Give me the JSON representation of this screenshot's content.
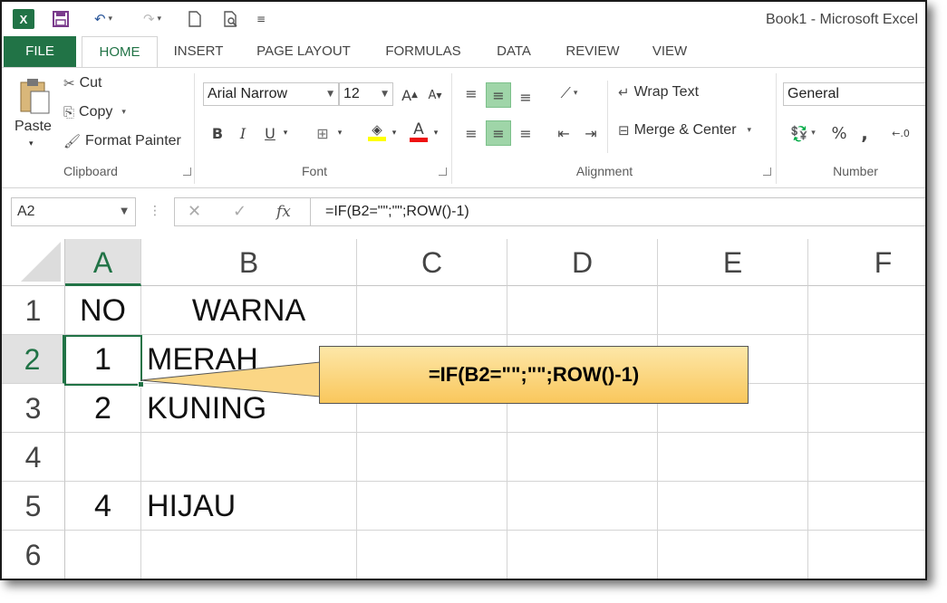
{
  "window": {
    "title": "Book1 - Microsoft Excel"
  },
  "tabs": [
    "FILE",
    "HOME",
    "INSERT",
    "PAGE LAYOUT",
    "FORMULAS",
    "DATA",
    "REVIEW",
    "VIEW"
  ],
  "ribbon": {
    "clipboard": {
      "label": "Clipboard",
      "paste": "Paste",
      "cut": "Cut",
      "copy": "Copy",
      "format_painter": "Format Painter"
    },
    "font": {
      "label": "Font",
      "font_name": "Arial Narrow",
      "font_size": "12",
      "bold": "B",
      "italic": "I",
      "underline": "U"
    },
    "alignment": {
      "label": "Alignment",
      "wrap_text": "Wrap Text",
      "merge_center": "Merge & Center"
    },
    "number": {
      "label": "Number",
      "format": "General",
      "percent": "%",
      "comma": ","
    }
  },
  "formula_bar": {
    "name_box": "A2",
    "fx": "fx",
    "formula": "=IF(B2=\"\";\"\";ROW()-1)"
  },
  "columns": [
    "A",
    "B",
    "C",
    "D",
    "E",
    "F"
  ],
  "rows": [
    "1",
    "2",
    "3",
    "4",
    "5",
    "6"
  ],
  "cells": {
    "A1": "NO",
    "B1": "WARNA",
    "A2": "1",
    "B2": "MERAH",
    "A3": "2",
    "B3": "KUNING",
    "A4": "",
    "B4": "",
    "A5": "4",
    "B5": "HIJAU",
    "A6": "",
    "B6": ""
  },
  "callout": {
    "text": "=IF(B2=\"\";\"\";ROW()-1)"
  },
  "colors": {
    "accent": "#217346",
    "selected_fill": "#9fd5a8",
    "callout_top": "#fde7a8",
    "callout_bottom": "#f9c75c"
  }
}
